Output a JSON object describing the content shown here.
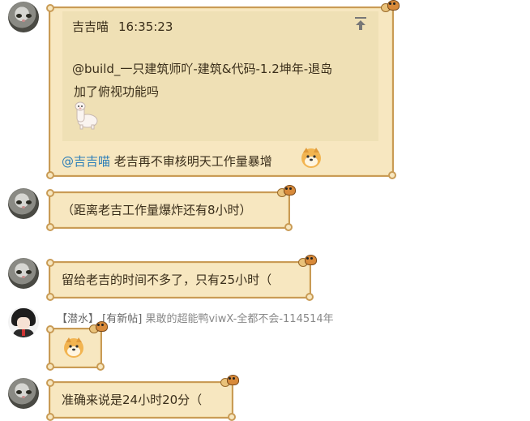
{
  "messages": [
    {
      "quote": {
        "author": "吉吉喵",
        "time": "16:35:23",
        "line1": "@build_一只建筑师吖-建筑&代码-1.2坤年-退岛",
        "line2": "加了俯视功能吗"
      },
      "mention": "@吉吉喵",
      "text": "老吉再不审核明天工作量暴增"
    },
    {
      "text": "（距离老吉工作量爆炸还有8小时）"
    },
    {
      "text": "留给老吉的时间不多了，只有25小时（"
    },
    {
      "meta": {
        "role_tag": "【潜水】",
        "new_post_tag": "[有新帖]",
        "sender": "果敢的超能鸭viwX-全都不会-114514年"
      }
    },
    {
      "text": "准确来说是24小时20分（"
    }
  ],
  "icons": {
    "pin": "pin-to-top-icon",
    "alpaca": "alpaca-sticker",
    "shiba": "shiba-emoji"
  },
  "colors": {
    "bubble_bg": "#f7e7c0",
    "bubble_border": "#c99b55",
    "quote_bg": "#efe0b5",
    "mention": "#2f7fb8"
  }
}
